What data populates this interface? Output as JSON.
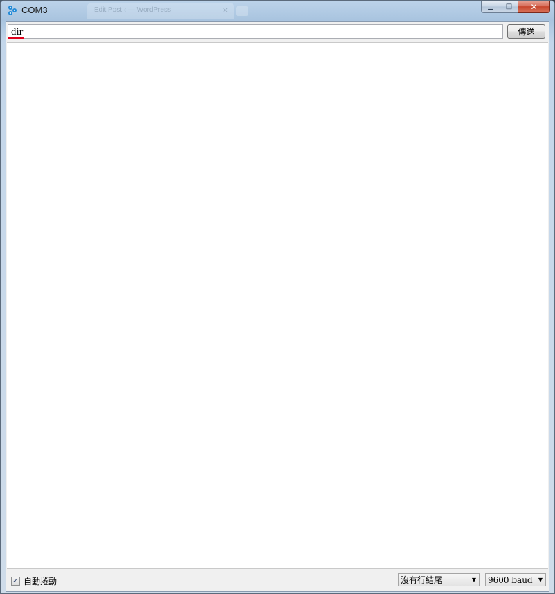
{
  "window": {
    "title": "COM3",
    "ghost_tab_title": "Edit Post ‹ — WordPress",
    "ghost_tab_close": "×",
    "controls": {
      "minimize": "▁",
      "maximize": "□",
      "close": "✕"
    }
  },
  "command": {
    "value": "dir",
    "send_label": "傳送"
  },
  "output": {
    "text": ""
  },
  "footer": {
    "autoscroll_label": "自動捲動",
    "autoscroll_checked_glyph": "✓",
    "line_ending": "沒有行結尾",
    "baud": "9600 baud"
  },
  "icons": {
    "app": "serial-monitor-icon",
    "dropdown": "chevron-down-icon"
  }
}
